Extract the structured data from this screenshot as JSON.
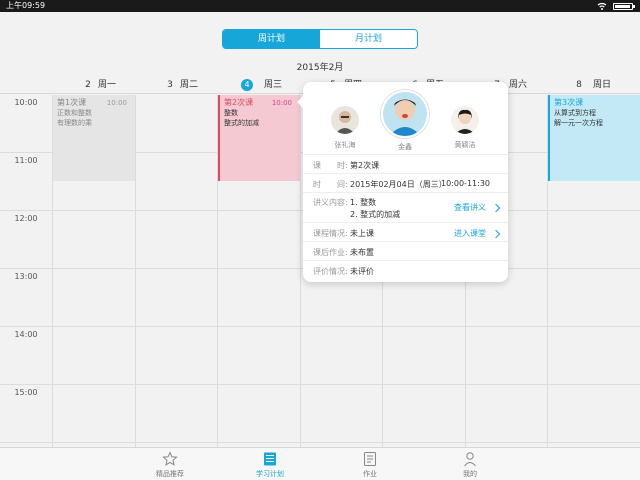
{
  "status_bar": {
    "time": "上午09:59"
  },
  "header": {
    "tabs": [
      {
        "label": "周计划",
        "active": true
      },
      {
        "label": "月计划",
        "active": false
      }
    ],
    "month": "2015年2月",
    "days": [
      {
        "num": "2",
        "weekday": "周一"
      },
      {
        "num": "3",
        "weekday": "周二"
      },
      {
        "num": "4",
        "weekday": "周三",
        "today": true
      },
      {
        "num": "5",
        "weekday": "周四"
      },
      {
        "num": "6",
        "weekday": "周五"
      },
      {
        "num": "7",
        "weekday": "周六"
      },
      {
        "num": "8",
        "weekday": "周日"
      }
    ]
  },
  "grid": {
    "hours": [
      "10:00",
      "11:00",
      "12:00",
      "13:00",
      "14:00",
      "15:00"
    ]
  },
  "events": [
    {
      "title": "第1次课",
      "time": "10:00",
      "line1": "正数和整数",
      "line2": "有理数的乘"
    },
    {
      "title": "第2次课",
      "time": "10:00",
      "line1": "整数",
      "line2": "整式的加减"
    },
    {
      "title": "第3次课",
      "line1": "从算式到方程",
      "line2": "解一元一次方程"
    }
  ],
  "popover": {
    "teachers": [
      {
        "name": "张礼海"
      },
      {
        "name": "金鑫"
      },
      {
        "name": "黄颖洁"
      }
    ],
    "rows": {
      "lesson": {
        "label": "课　　时:",
        "value": "第2次课"
      },
      "time": {
        "label": "时　　间:",
        "date": "2015年02月04日（周三）",
        "range": "10:00-11:30"
      },
      "content": {
        "label": "讲义内容:",
        "item1": "1. 整数",
        "item2": "2. 整式的加减",
        "link": "查看讲义"
      },
      "status": {
        "label": "课程情况:",
        "value": "未上课",
        "link": "进入课堂"
      },
      "homework": {
        "label": "课后作业:",
        "value": "未布置"
      },
      "review": {
        "label": "评价情况:",
        "value": "未评价"
      }
    }
  },
  "tabbar": [
    {
      "label": "精品推荐",
      "icon": "star-icon"
    },
    {
      "label": "学习计划",
      "icon": "plan-icon",
      "active": true
    },
    {
      "label": "作业",
      "icon": "homework-icon"
    },
    {
      "label": "我的",
      "icon": "person-icon"
    }
  ],
  "colors": {
    "accent": "#17a6d8",
    "pink": "#e04a68",
    "pink_bg": "#f5c9d1",
    "blue_bg": "#c3e9f6"
  }
}
